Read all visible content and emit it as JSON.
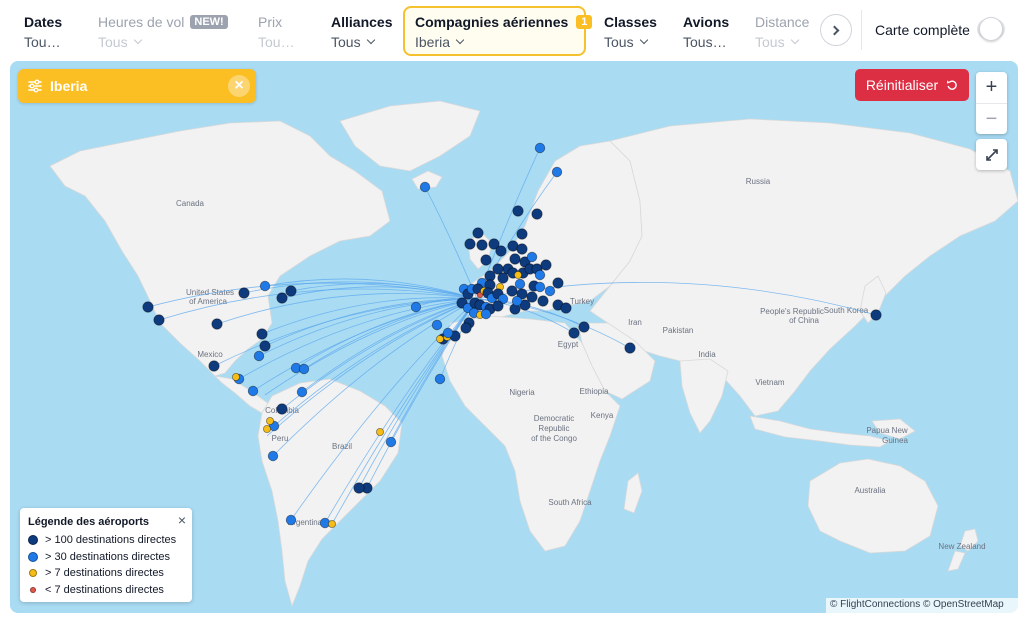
{
  "filters": [
    {
      "title": "Dates",
      "value": "Tou…",
      "disabled": false,
      "chevron": false
    },
    {
      "title": "Heures de vol",
      "badge": "NEW!",
      "value": "Tous",
      "disabled": true,
      "chevron": true
    },
    {
      "title": "Prix",
      "value": "Tou…",
      "disabled": true,
      "chevron": false
    },
    {
      "title": "Alliances",
      "value": "Tous",
      "disabled": false,
      "chevron": true
    },
    {
      "title": "Compagnies aériennes",
      "badge": "1",
      "value": "Iberia",
      "disabled": false,
      "chevron": true,
      "active": true
    },
    {
      "title": "Classes",
      "value": "Tous",
      "disabled": false,
      "chevron": true
    },
    {
      "title": "Avions",
      "value": "Tous…",
      "disabled": false,
      "chevron": false
    },
    {
      "title": "Distance",
      "value": "Tous",
      "disabled": true,
      "chevron": true
    }
  ],
  "full_map": {
    "label": "Carte complète",
    "enabled": false
  },
  "selected_airline": {
    "label": "Iberia",
    "icon": "sliders-icon"
  },
  "reset_button": {
    "label": "Réinitialiser",
    "icon": "undo-icon"
  },
  "zoom": {
    "in": "+",
    "out": "−"
  },
  "map_labels": {
    "canada": "Canada",
    "usa_1": "United States",
    "usa_2": "of America",
    "mexico": "Mexico",
    "colombia": "Colombia",
    "peru": "Peru",
    "brazil": "Brazil",
    "argentina": "Argentina",
    "russia": "Russia",
    "turkey": "Turkey",
    "iran": "Iran",
    "egypt": "Egypt",
    "pakistan": "Pakistan",
    "india": "India",
    "china_1": "People's Republic",
    "china_2": "of China",
    "south_korea": "South Korea",
    "vietnam": "Vietnam",
    "nigeria": "Nigeria",
    "ethiopia": "Ethiopia",
    "kenya": "Kenya",
    "drc_1": "Democratic",
    "drc_2": "Republic",
    "drc_3": "of the Congo",
    "south_africa": "South Africa",
    "australia": "Australia",
    "png_1": "Papua New",
    "png_2": "Guinea",
    "new_zealand": "New Zealand"
  },
  "legend": {
    "title": "Légende des aéroports",
    "items": [
      {
        "label": "> 100 destinations directes",
        "color": "#0e3a7e"
      },
      {
        "label": "> 30 destinations directes",
        "color": "#1f7ae8"
      },
      {
        "label": "> 7 destinations directes",
        "color": "#f6bd16"
      },
      {
        "label": "< 7 destinations directes",
        "color": "#e0584a"
      }
    ]
  },
  "attribution": "© FlightConnections © OpenStreetMap",
  "colors": {
    "ocean": "#a9dbf3",
    "land": "#f2f2f2",
    "route": "#5aa7ee",
    "hub_dark": "#0e3a7e",
    "hub_mid": "#1f7ae8",
    "hub_small": "#f6bd16",
    "hub_tiny": "#e0584a",
    "accent": "#fbbf24",
    "reset": "#dc2f44"
  }
}
